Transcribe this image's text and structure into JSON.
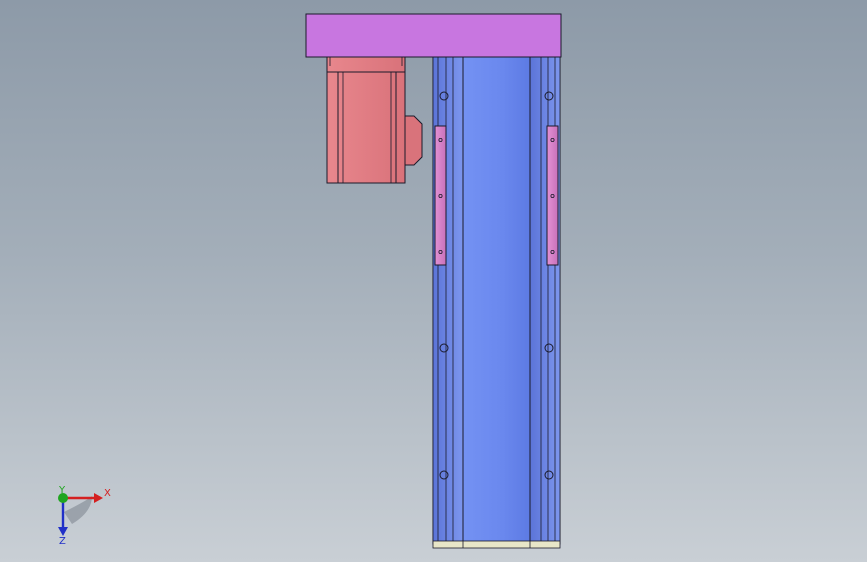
{
  "viewport": {
    "background_top": "#8d9aa8",
    "background_bottom": "#c9cfd5"
  },
  "model": {
    "top_plate_color": "#c876e0",
    "motor_color": "#e07b82",
    "rail_color": "#6f8ff0",
    "carriage_color": "#d480c8"
  },
  "triad": {
    "x_label": "X",
    "y_label": "Y",
    "z_label": "Z",
    "x_color": "#d42020",
    "y_color": "#1fa51f",
    "z_color": "#2030c8"
  }
}
